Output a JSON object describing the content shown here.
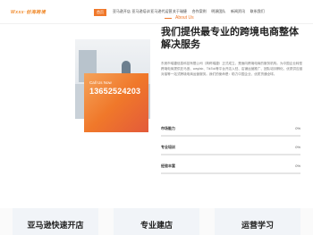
{
  "header": {
    "logo_text": "Wxxx·创海跨境",
    "nav": [
      {
        "label": "首页",
        "active": true
      },
      {
        "label": "亚马逊开店",
        "active": false
      },
      {
        "label": "亚马逊培训",
        "active": false
      },
      {
        "label": "亚马逊代运营",
        "active": false
      },
      {
        "label": "关于瑞捷",
        "active": false
      },
      {
        "label": "合作案例",
        "active": false
      },
      {
        "label": "明源团队",
        "active": false
      },
      {
        "label": "新闻资讯",
        "active": false
      },
      {
        "label": "联系我们",
        "active": false
      }
    ]
  },
  "about": {
    "label": "About Us",
    "title": "我们提供最专业的跨境电商整体解决服务",
    "description": "东莞市瑞捷信息科技有限公司（简称瑞捷）正式成立，是面向跨境电商的服务机构。为中国企业转型跨境电商提供亚马逊、wayfair、TikTok等平台开店入驻、店铺运营推广、团队培训孵化、优质供应链对接等一站式跨境电商运营服务。我们的使命是：助力中国企业，优质货通全球。",
    "call_label": "Call Us Now",
    "call_number": "13652524203"
  },
  "progress": [
    {
      "label": "市场能力",
      "value": 0,
      "display": "0%"
    },
    {
      "label": "专业培训",
      "value": 0,
      "display": "0%"
    },
    {
      "label": "经验丰富",
      "value": 0,
      "display": "0%"
    }
  ],
  "services": [
    {
      "title": "亚马逊快速开店"
    },
    {
      "title": "专业建店"
    },
    {
      "title": "运营学习"
    }
  ],
  "colors": {
    "accent": "#f0782a",
    "title": "#222222"
  }
}
